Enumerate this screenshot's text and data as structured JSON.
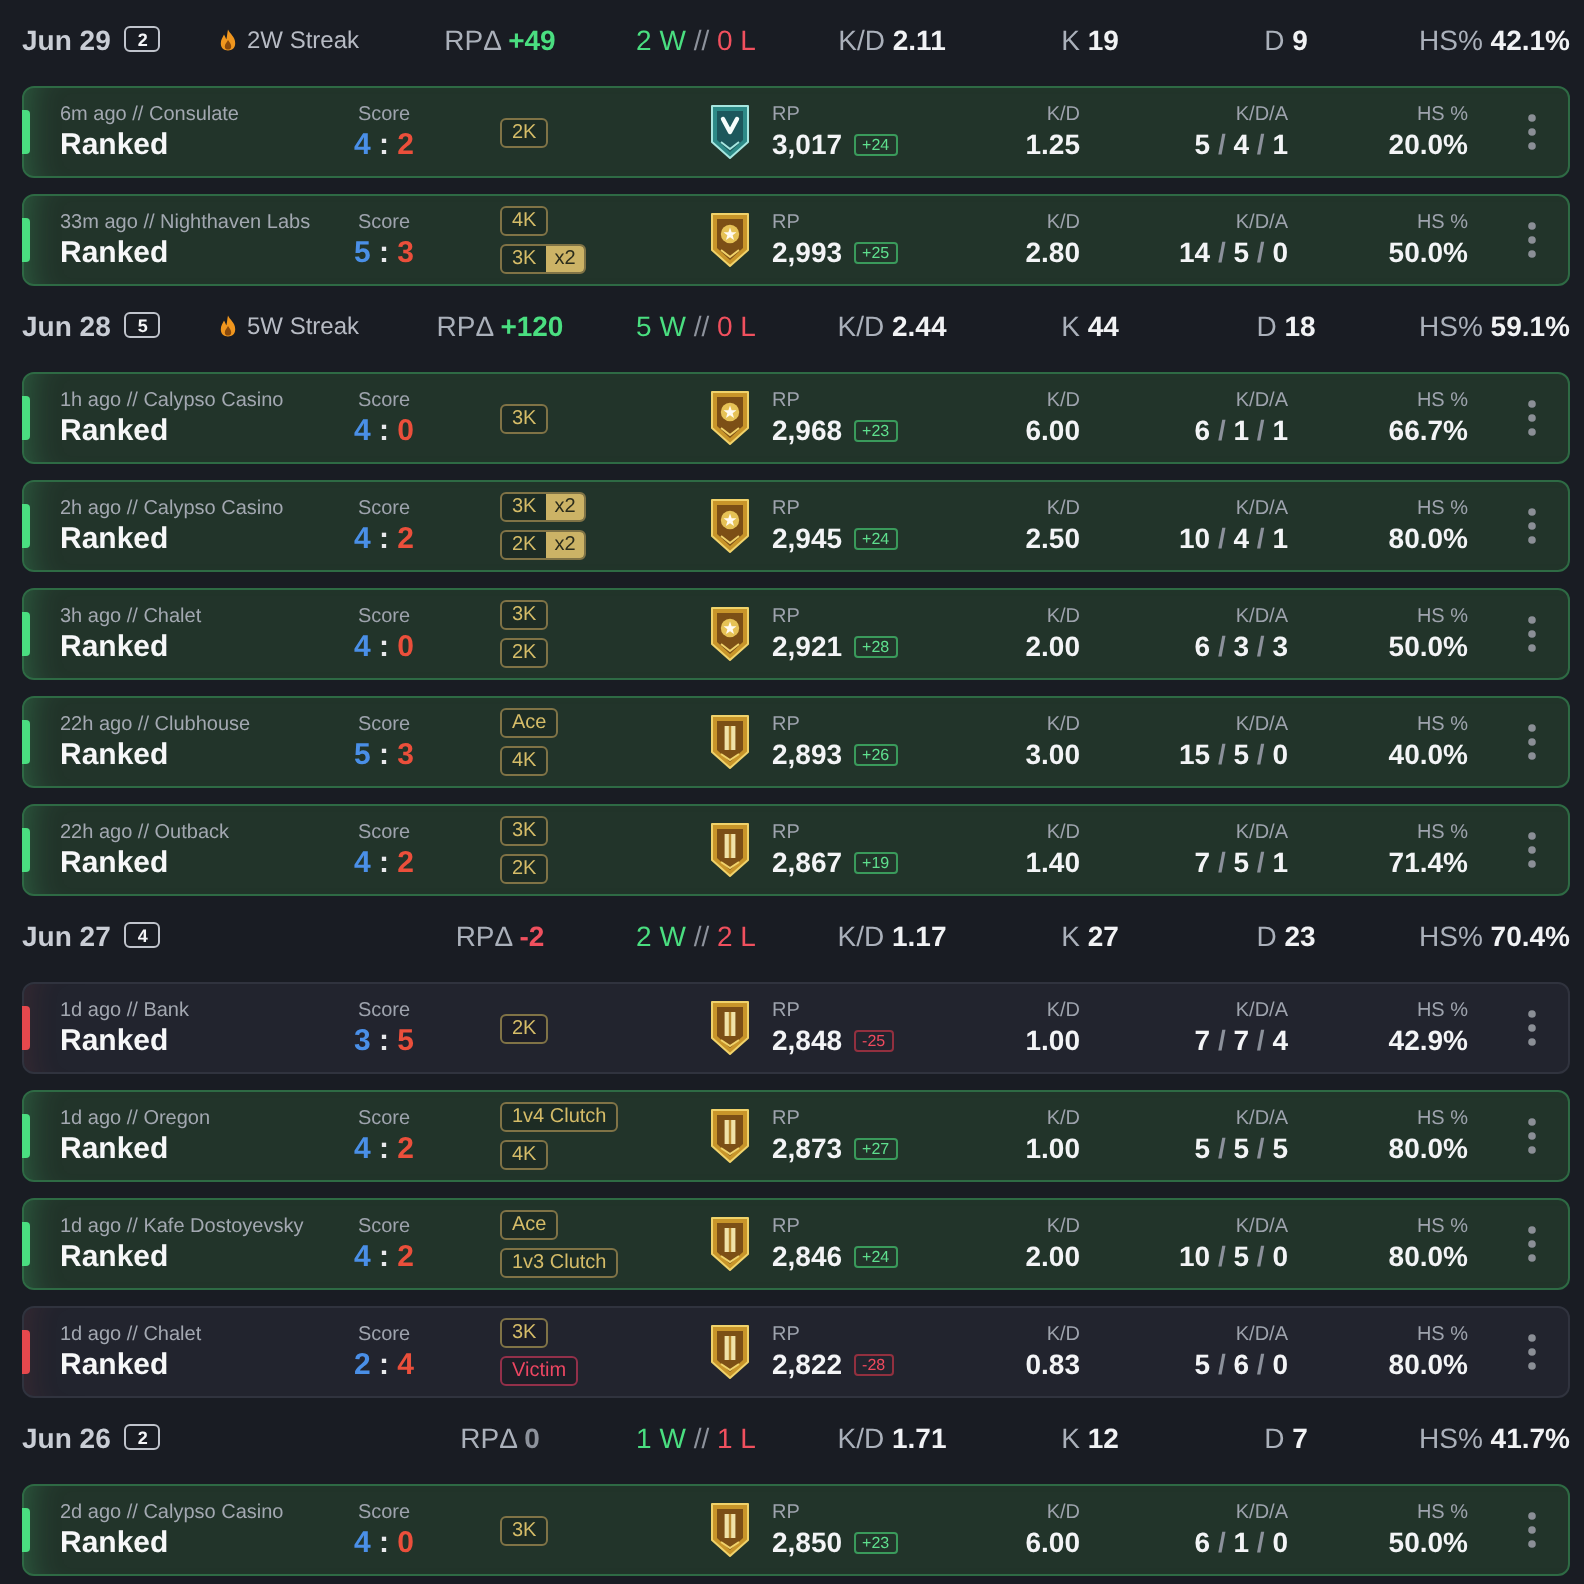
{
  "days": [
    {
      "date": "Jun 29",
      "count": "2",
      "streak": "2W Streak",
      "rp_delta": {
        "label": "RPΔ",
        "value": "+49",
        "color": "#4ade80"
      },
      "record": {
        "wins": "2 W",
        "separator": "//",
        "losses": "0 L"
      },
      "stats": [
        {
          "label": "K/D",
          "value": "2.11"
        },
        {
          "label": "K",
          "value": "19"
        },
        {
          "label": "D",
          "value": "9"
        },
        {
          "label": "HS%",
          "value": "42.1%"
        }
      ],
      "matches": [
        {
          "won": true,
          "meta": "6m ago // Consulate",
          "mode": "Ranked",
          "score": {
            "label": "Score",
            "team": "4",
            "separator": ":",
            "enemy": "2"
          },
          "tags": [
            {
              "kind": "feat",
              "label": "2K"
            }
          ],
          "rank": {
            "kind": "chevron"
          },
          "rp": {
            "label": "RP",
            "value": "3,017",
            "change": "+24"
          },
          "kd": {
            "label": "K/D",
            "value": "1.25"
          },
          "kda": {
            "label": "K/D/A",
            "parts": [
              "5",
              "/",
              "4",
              "/",
              "1"
            ]
          },
          "hs": {
            "label": "HS %",
            "value": "20.0%"
          }
        },
        {
          "won": true,
          "meta": "33m ago // Nighthaven Labs",
          "mode": "Ranked",
          "score": {
            "label": "Score",
            "team": "5",
            "separator": ":",
            "enemy": "3"
          },
          "tags": [
            {
              "kind": "feat",
              "label": "4K"
            },
            {
              "kind": "feat",
              "label": "3K",
              "multiplier": "x2"
            }
          ],
          "rank": {
            "kind": "star"
          },
          "rp": {
            "label": "RP",
            "value": "2,993",
            "change": "+25"
          },
          "kd": {
            "label": "K/D",
            "value": "2.80"
          },
          "kda": {
            "label": "K/D/A",
            "parts": [
              "14",
              "/",
              "5",
              "/",
              "0"
            ]
          },
          "hs": {
            "label": "HS %",
            "value": "50.0%"
          }
        }
      ]
    },
    {
      "date": "Jun 28",
      "count": "5",
      "streak": "5W Streak",
      "rp_delta": {
        "label": "RPΔ",
        "value": "+120",
        "color": "#4ade80"
      },
      "record": {
        "wins": "5 W",
        "separator": "//",
        "losses": "0 L"
      },
      "stats": [
        {
          "label": "K/D",
          "value": "2.44"
        },
        {
          "label": "K",
          "value": "44"
        },
        {
          "label": "D",
          "value": "18"
        },
        {
          "label": "HS%",
          "value": "59.1%"
        }
      ],
      "matches": [
        {
          "won": true,
          "meta": "1h ago // Calypso Casino",
          "mode": "Ranked",
          "score": {
            "label": "Score",
            "team": "4",
            "separator": ":",
            "enemy": "0"
          },
          "tags": [
            {
              "kind": "feat",
              "label": "3K"
            }
          ],
          "rank": {
            "kind": "star"
          },
          "rp": {
            "label": "RP",
            "value": "2,968",
            "change": "+23"
          },
          "kd": {
            "label": "K/D",
            "value": "6.00"
          },
          "kda": {
            "label": "K/D/A",
            "parts": [
              "6",
              "/",
              "1",
              "/",
              "1"
            ]
          },
          "hs": {
            "label": "HS %",
            "value": "66.7%"
          }
        },
        {
          "won": true,
          "meta": "2h ago // Calypso Casino",
          "mode": "Ranked",
          "score": {
            "label": "Score",
            "team": "4",
            "separator": ":",
            "enemy": "2"
          },
          "tags": [
            {
              "kind": "feat",
              "label": "3K",
              "multiplier": "x2"
            },
            {
              "kind": "feat",
              "label": "2K",
              "multiplier": "x2"
            }
          ],
          "rank": {
            "kind": "star"
          },
          "rp": {
            "label": "RP",
            "value": "2,945",
            "change": "+24"
          },
          "kd": {
            "label": "K/D",
            "value": "2.50"
          },
          "kda": {
            "label": "K/D/A",
            "parts": [
              "10",
              "/",
              "4",
              "/",
              "1"
            ]
          },
          "hs": {
            "label": "HS %",
            "value": "80.0%"
          }
        },
        {
          "won": true,
          "meta": "3h ago // Chalet",
          "mode": "Ranked",
          "score": {
            "label": "Score",
            "team": "4",
            "separator": ":",
            "enemy": "0"
          },
          "tags": [
            {
              "kind": "feat",
              "label": "3K"
            },
            {
              "kind": "feat",
              "label": "2K"
            }
          ],
          "rank": {
            "kind": "star"
          },
          "rp": {
            "label": "RP",
            "value": "2,921",
            "change": "+28"
          },
          "kd": {
            "label": "K/D",
            "value": "2.00"
          },
          "kda": {
            "label": "K/D/A",
            "parts": [
              "6",
              "/",
              "3",
              "/",
              "3"
            ]
          },
          "hs": {
            "label": "HS %",
            "value": "50.0%"
          }
        },
        {
          "won": true,
          "meta": "22h ago // Clubhouse",
          "mode": "Ranked",
          "score": {
            "label": "Score",
            "team": "5",
            "separator": ":",
            "enemy": "3"
          },
          "tags": [
            {
              "kind": "feat",
              "label": "Ace"
            },
            {
              "kind": "feat",
              "label": "4K"
            }
          ],
          "rank": {
            "kind": "bar"
          },
          "rp": {
            "label": "RP",
            "value": "2,893",
            "change": "+26"
          },
          "kd": {
            "label": "K/D",
            "value": "3.00"
          },
          "kda": {
            "label": "K/D/A",
            "parts": [
              "15",
              "/",
              "5",
              "/",
              "0"
            ]
          },
          "hs": {
            "label": "HS %",
            "value": "40.0%"
          }
        },
        {
          "won": true,
          "meta": "22h ago // Outback",
          "mode": "Ranked",
          "score": {
            "label": "Score",
            "team": "4",
            "separator": ":",
            "enemy": "2"
          },
          "tags": [
            {
              "kind": "feat",
              "label": "3K"
            },
            {
              "kind": "feat",
              "label": "2K"
            }
          ],
          "rank": {
            "kind": "bar"
          },
          "rp": {
            "label": "RP",
            "value": "2,867",
            "change": "+19"
          },
          "kd": {
            "label": "K/D",
            "value": "1.40"
          },
          "kda": {
            "label": "K/D/A",
            "parts": [
              "7",
              "/",
              "5",
              "/",
              "1"
            ]
          },
          "hs": {
            "label": "HS %",
            "value": "71.4%"
          }
        }
      ]
    },
    {
      "date": "Jun 27",
      "count": "4",
      "rp_delta": {
        "label": "RPΔ",
        "value": "-2",
        "color": "#f0505e"
      },
      "record": {
        "wins": "2 W",
        "separator": "//",
        "losses": "2 L"
      },
      "stats": [
        {
          "label": "K/D",
          "value": "1.17"
        },
        {
          "label": "K",
          "value": "27"
        },
        {
          "label": "D",
          "value": "23"
        },
        {
          "label": "HS%",
          "value": "70.4%"
        }
      ],
      "matches": [
        {
          "won": false,
          "meta": "1d ago // Bank",
          "mode": "Ranked",
          "score": {
            "label": "Score",
            "team": "3",
            "separator": ":",
            "enemy": "5"
          },
          "tags": [
            {
              "kind": "feat",
              "label": "2K"
            }
          ],
          "rank": {
            "kind": "bar"
          },
          "rp": {
            "label": "RP",
            "value": "2,848",
            "change": "-25"
          },
          "kd": {
            "label": "K/D",
            "value": "1.00"
          },
          "kda": {
            "label": "K/D/A",
            "parts": [
              "7",
              "/",
              "7",
              "/",
              "4"
            ]
          },
          "hs": {
            "label": "HS %",
            "value": "42.9%"
          }
        },
        {
          "won": true,
          "meta": "1d ago // Oregon",
          "mode": "Ranked",
          "score": {
            "label": "Score",
            "team": "4",
            "separator": ":",
            "enemy": "2"
          },
          "tags": [
            {
              "kind": "feat",
              "label": "1v4 Clutch"
            },
            {
              "kind": "feat",
              "label": "4K"
            }
          ],
          "rank": {
            "kind": "bar"
          },
          "rp": {
            "label": "RP",
            "value": "2,873",
            "change": "+27"
          },
          "kd": {
            "label": "K/D",
            "value": "1.00"
          },
          "kda": {
            "label": "K/D/A",
            "parts": [
              "5",
              "/",
              "5",
              "/",
              "5"
            ]
          },
          "hs": {
            "label": "HS %",
            "value": "80.0%"
          }
        },
        {
          "won": true,
          "meta": "1d ago // Kafe Dostoyevsky",
          "mode": "Ranked",
          "score": {
            "label": "Score",
            "team": "4",
            "separator": ":",
            "enemy": "2"
          },
          "tags": [
            {
              "kind": "feat",
              "label": "Ace"
            },
            {
              "kind": "feat",
              "label": "1v3 Clutch"
            }
          ],
          "rank": {
            "kind": "bar"
          },
          "rp": {
            "label": "RP",
            "value": "2,846",
            "change": "+24"
          },
          "kd": {
            "label": "K/D",
            "value": "2.00"
          },
          "kda": {
            "label": "K/D/A",
            "parts": [
              "10",
              "/",
              "5",
              "/",
              "0"
            ]
          },
          "hs": {
            "label": "HS %",
            "value": "80.0%"
          }
        },
        {
          "won": false,
          "meta": "1d ago // Chalet",
          "mode": "Ranked",
          "score": {
            "label": "Score",
            "team": "2",
            "separator": ":",
            "enemy": "4"
          },
          "tags": [
            {
              "kind": "feat",
              "label": "3K"
            },
            {
              "kind": "penalty",
              "label": "Victim"
            }
          ],
          "rank": {
            "kind": "bar"
          },
          "rp": {
            "label": "RP",
            "value": "2,822",
            "change": "-28"
          },
          "kd": {
            "label": "K/D",
            "value": "0.83"
          },
          "kda": {
            "label": "K/D/A",
            "parts": [
              "5",
              "/",
              "6",
              "/",
              "0"
            ]
          },
          "hs": {
            "label": "HS %",
            "value": "80.0%"
          }
        }
      ]
    },
    {
      "date": "Jun 26",
      "count": "2",
      "rp_delta": {
        "label": "RPΔ",
        "value": "0",
        "color": "#8d929c"
      },
      "record": {
        "wins": "1 W",
        "separator": "//",
        "losses": "1 L"
      },
      "stats": [
        {
          "label": "K/D",
          "value": "1.71"
        },
        {
          "label": "K",
          "value": "12"
        },
        {
          "label": "D",
          "value": "7"
        },
        {
          "label": "HS%",
          "value": "41.7%"
        }
      ],
      "matches": [
        {
          "won": true,
          "meta": "2d ago // Calypso Casino",
          "mode": "Ranked",
          "score": {
            "label": "Score",
            "team": "4",
            "separator": ":",
            "enemy": "0"
          },
          "tags": [
            {
              "kind": "feat",
              "label": "3K"
            }
          ],
          "rank": {
            "kind": "bar"
          },
          "rp": {
            "label": "RP",
            "value": "2,850",
            "change": "+23"
          },
          "kd": {
            "label": "K/D",
            "value": "6.00"
          },
          "kda": {
            "label": "K/D/A",
            "parts": [
              "6",
              "/",
              "1",
              "/",
              "0"
            ]
          },
          "hs": {
            "label": "HS %",
            "value": "50.0%"
          }
        }
      ]
    }
  ]
}
